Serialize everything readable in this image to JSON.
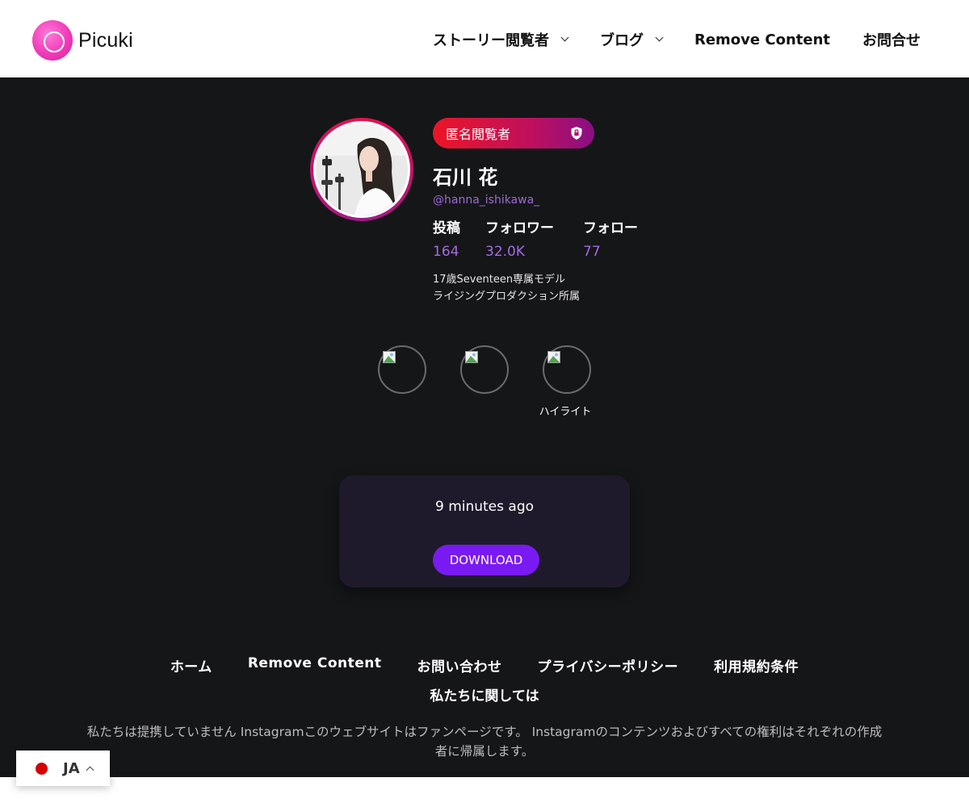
{
  "header": {
    "logo_text": "Picuki",
    "nav": {
      "story_viewer": "ストーリー閲覧者",
      "blog": "ブログ",
      "remove_content": "Remove Content",
      "contact": "お問合せ"
    }
  },
  "profile": {
    "badge": "匿名閲覧者",
    "name": "石川 花",
    "handle": "@hanna_ishikawa_",
    "stats": [
      {
        "label": "投稿",
        "value": "164"
      },
      {
        "label": "フォロワー",
        "value": "32.0K"
      },
      {
        "label": "フォロー",
        "value": "77"
      }
    ],
    "bio_lines": [
      "17歳Seventeen専属モデル",
      "ライジングプロダクション所属"
    ]
  },
  "highlights": {
    "label": "ハイライト"
  },
  "story_card": {
    "time": "9 minutes ago",
    "download_label": "DOWNLOAD"
  },
  "footer": {
    "links": [
      "ホーム",
      "Remove Content",
      "お問い合わせ",
      "プライバシーポリシー",
      "利用規約条件"
    ],
    "about": "私たちに関しては",
    "disclaimer": "私たちは提携していません Instagramこのウェブサイトはファンページです。 Instagramのコンテンツおよびすべての権利はそれぞれの作成者に帰属します。"
  },
  "language": {
    "code": "JA"
  },
  "colors": {
    "accent_purple": "#7a1af2",
    "stat_value": "#a36be0",
    "handle": "#9b6ad4",
    "background_dark": "#151618",
    "card_bg": "#1f1a2b",
    "flag_red": "#d60000"
  }
}
